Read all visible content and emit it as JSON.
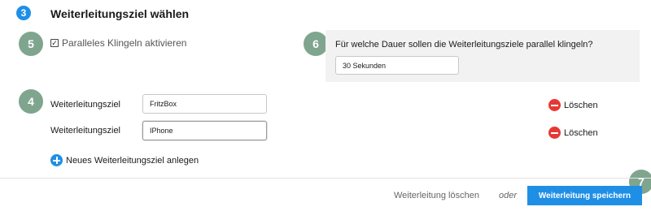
{
  "section": {
    "step_number": "3",
    "title": "Weiterleitungsziel wählen"
  },
  "markers": {
    "m5": "5",
    "m6": "6",
    "m4": "4",
    "m7": "7"
  },
  "parallel_ring": {
    "label": "Paralleles Klingeln aktivieren",
    "checked": true,
    "check_glyph": "☑"
  },
  "duration": {
    "question": "Für welche Dauer sollen die Weiterleitungsziele parallel klingeln?",
    "selected": "30 Sekunden"
  },
  "targets": [
    {
      "label": "Weiterleitungsziel",
      "value": "FritzBox",
      "delete_label": "Löschen"
    },
    {
      "label": "Weiterleitungsziel",
      "value": "IPhone",
      "delete_label": "Löschen"
    }
  ],
  "add_target": {
    "label": "Neues Weiterleitungsziel anlegen"
  },
  "footer": {
    "delete_forwarding": "Weiterleitung löschen",
    "or": "oder",
    "save": "Weiterleitung speichern"
  },
  "colors": {
    "primary": "#1f8fe6",
    "marker": "#7fa58f",
    "danger": "#e53935",
    "panel": "#f2f2f2"
  }
}
